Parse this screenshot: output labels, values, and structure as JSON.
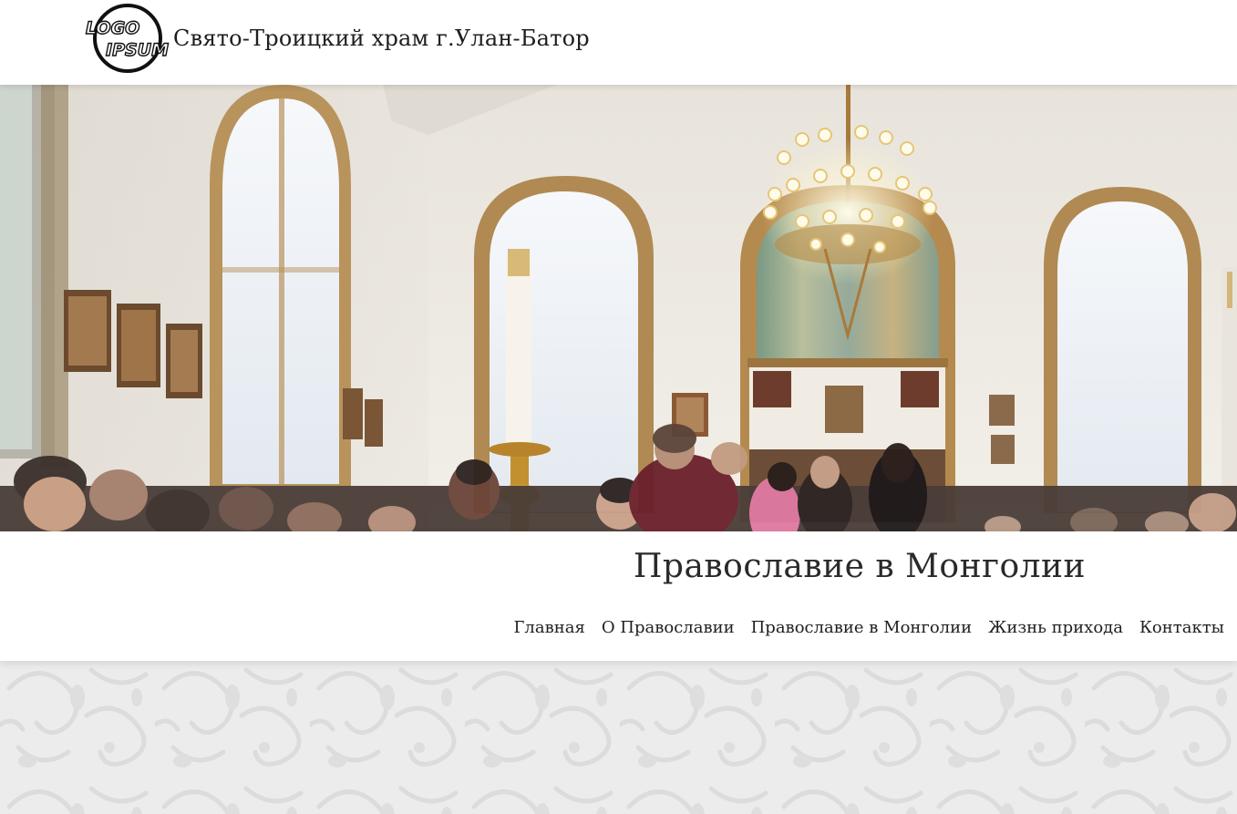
{
  "header": {
    "logo_text_top": "LOGO",
    "logo_text_bottom": "IPSUM",
    "site_title": "Свято-Троицкий храм г.Улан-Батор"
  },
  "hero": {
    "image": "church-interior-photo"
  },
  "section": {
    "title": "Православие в Монголии"
  },
  "nav": {
    "items": [
      {
        "label": "Главная"
      },
      {
        "label": "О Православии"
      },
      {
        "label": "Православие в Монголии"
      },
      {
        "label": "Жизнь прихода"
      },
      {
        "label": "Контакты"
      }
    ]
  },
  "colors": {
    "background": "#ffffff",
    "pattern_bg": "#ececec",
    "text": "#222222"
  }
}
